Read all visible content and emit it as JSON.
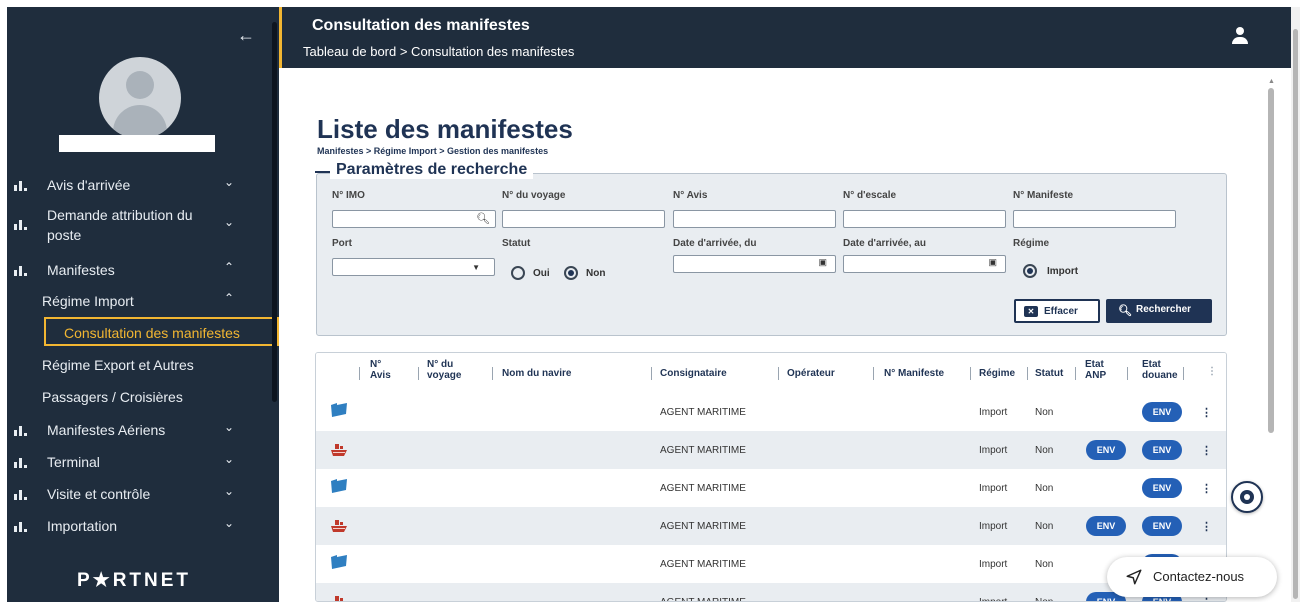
{
  "header": {
    "title": "Consultation des manifestes",
    "breadcrumb": "Tableau de bord > Consultation des manifestes"
  },
  "sidebar": {
    "back": "←",
    "items": [
      {
        "label": "Avis d'arrivée",
        "chevron": "⌄"
      },
      {
        "label": "Demande attribution du",
        "label2": "poste",
        "chevron": "⌄"
      },
      {
        "label": "Manifestes",
        "chevron": "⌃"
      },
      {
        "label": "Manifestes Aériens",
        "chevron": "⌄"
      },
      {
        "label": "Terminal",
        "chevron": "⌄"
      },
      {
        "label": "Visite et contrôle",
        "chevron": "⌄"
      },
      {
        "label": "Importation",
        "chevron": "⌄"
      }
    ],
    "sub": {
      "regime_import": "Régime Import",
      "regime_import_chevron": "⌃",
      "consultation": "Consultation des manifestes",
      "regime_export": "Régime Export et Autres",
      "passagers": "Passagers / Croisières"
    },
    "logo": "P★RTNET"
  },
  "main": {
    "title": "Liste des manifestes",
    "breadcrumb": "Manifestes > Régime Import > Gestion des manifestes",
    "search": {
      "legend": "Paramètres de recherche",
      "labels": {
        "imo": "N° IMO",
        "voyage": "N° du voyage",
        "avis": "N° Avis",
        "escale": "N° d'escale",
        "manifeste": "N° Manifeste",
        "port": "Port",
        "statut": "Statut",
        "date_du": "Date d'arrivée, du",
        "date_au": "Date d'arrivée, au",
        "regime": "Régime"
      },
      "statut_options": [
        "Oui",
        "Non"
      ],
      "statut_selected": "Non",
      "regime_option": "Import",
      "clear_label": "Effacer",
      "search_label": "Rechercher"
    },
    "table": {
      "columns": {
        "avis": [
          "N°",
          "Avis"
        ],
        "voyage": [
          "N° du",
          "voyage"
        ],
        "navire": "Nom du navire",
        "consignataire": "Consignataire",
        "operateur": "Opérateur",
        "manifeste": "N° Manifeste",
        "regime": "Régime",
        "statut": "Statut",
        "etat_anp": [
          "Etat",
          "ANP"
        ],
        "etat_douane": [
          "Etat",
          "douane"
        ]
      },
      "rows": [
        {
          "icon": "folder",
          "consignataire": "AGENT MARITIME",
          "regime": "Import",
          "statut": "Non",
          "anp": "",
          "douane": "ENV"
        },
        {
          "icon": "ship",
          "consignataire": "AGENT MARITIME",
          "regime": "Import",
          "statut": "Non",
          "anp": "ENV",
          "douane": "ENV"
        },
        {
          "icon": "folder",
          "consignataire": "AGENT MARITIME",
          "regime": "Import",
          "statut": "Non",
          "anp": "",
          "douane": "ENV"
        },
        {
          "icon": "ship",
          "consignataire": "AGENT MARITIME",
          "regime": "Import",
          "statut": "Non",
          "anp": "ENV",
          "douane": "ENV"
        },
        {
          "icon": "folder",
          "consignataire": "AGENT MARITIME",
          "regime": "Import",
          "statut": "Non",
          "anp": "",
          "douane": "ENV"
        },
        {
          "icon": "ship",
          "consignataire": "AGENT MARITIME",
          "regime": "Import",
          "statut": "Non",
          "anp": "ENV",
          "douane": "ENV"
        }
      ]
    }
  },
  "contact": {
    "label": "Contactez-nous"
  },
  "colors": {
    "navy": "#1f2d3d",
    "accent": "#f2b632",
    "pill": "#2460b6",
    "dark_blue": "#1f3354"
  }
}
